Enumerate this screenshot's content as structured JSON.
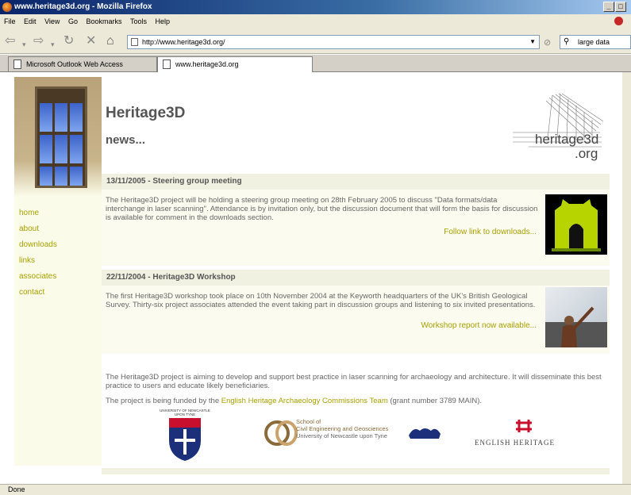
{
  "window": {
    "title": "www.heritage3d.org - Mozilla Firefox"
  },
  "menu": [
    "File",
    "Edit",
    "View",
    "Go",
    "Bookmarks",
    "Tools",
    "Help"
  ],
  "toolbar": {
    "url": "http://www.heritage3d.org/",
    "search_value": "large data"
  },
  "tabs": [
    {
      "label": "Microsoft Outlook Web Access"
    },
    {
      "label": "www.heritage3d.org"
    }
  ],
  "site": {
    "title": "Heritage3D",
    "subtitle": "news...",
    "logo_text": "heritage3d.org",
    "nav": [
      "home",
      "about",
      "downloads",
      "links",
      "associates",
      "contact"
    ],
    "news": [
      {
        "heading": "13/11/2005 - Steering group meeting",
        "body": "The Heritage3D project will be holding a steering group meeting on 28th February 2005 to discuss \"Data formats/data interchange in laser scanning\". Attendance is by invitation only, but the discussion document that will form the basis for discussion is available for comment in the downloads section.",
        "link": "Follow link to downloads..."
      },
      {
        "heading": "22/11/2004 - Heritage3D Workshop",
        "body": "The first Heritage3D workshop took place on 10th November 2004 at the Keyworth headquarters of the UK's British Geological Survey.  Thirty-six project associates attended the event taking part in discussion groups and listening to six invited presentations.",
        "link": "Workshop report now available..."
      }
    ],
    "about_text": "The Heritage3D project is aiming to develop and support best practice in laser scanning for archaeology and architecture. It will disseminate this best practice to users and educate likely beneficiaries.",
    "funding_prefix": "The project is being funded by the ",
    "funding_link": "English Heritage Archaeology Commissions Team",
    "funding_suffix": " (grant number 3789 MAIN).",
    "logos": {
      "newcastle": "UNIVERSITY OF NEWCASTLE UPON TYNE",
      "school_line1": "School of",
      "school_line2": "Civil Engineering and Geosciences",
      "school_line3": "University of Newcastle upon Tyne",
      "english_heritage": "ENGLISH HERITAGE"
    }
  },
  "status": "Done",
  "colors": {
    "accent": "#a7a000",
    "header_bg": "#f1f1e2",
    "sidebar_bg": "#fbfbe9"
  }
}
